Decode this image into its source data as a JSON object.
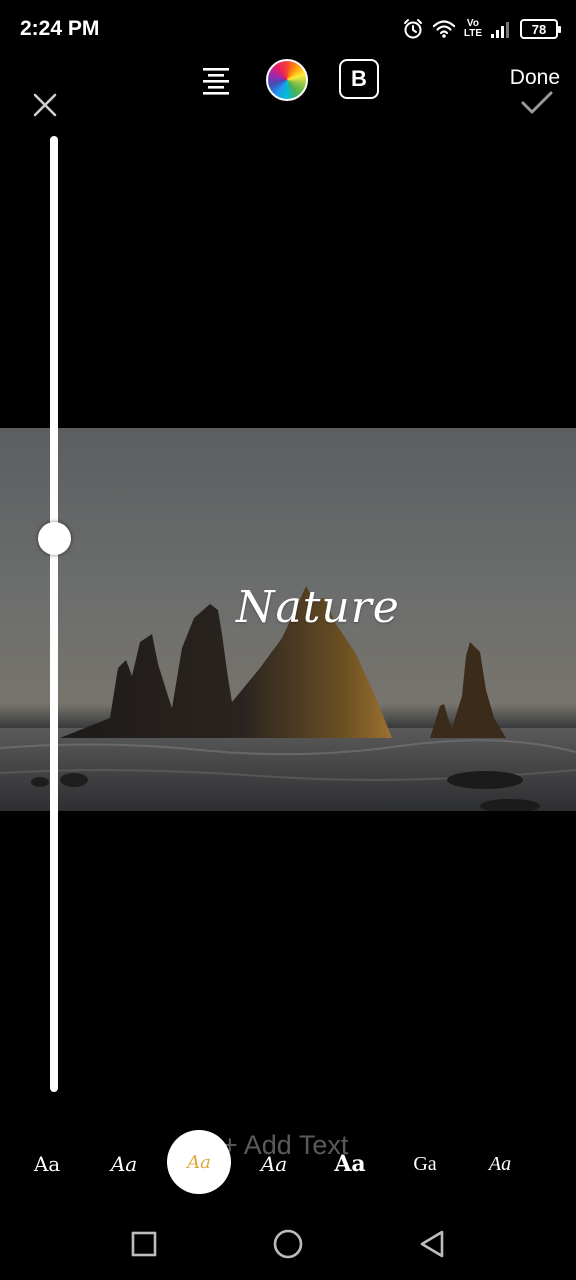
{
  "status_bar": {
    "time": "2:24 PM",
    "volte_top": "Vo",
    "volte_bottom": "LTE",
    "battery": "78",
    "icons": [
      "alarm-icon",
      "wifi-icon",
      "signal-icon",
      "battery-icon"
    ]
  },
  "toolbar": {
    "done_label": "Done",
    "bold_label": "B",
    "icons": [
      "close-icon",
      "align-center-icon",
      "color-wheel-icon",
      "bold-icon",
      "check-icon"
    ]
  },
  "canvas": {
    "overlay_text": "Nature",
    "add_text_label": "+ Add Text"
  },
  "slider": {
    "level": 0.58
  },
  "font_picker": {
    "options": [
      "Aa",
      "Aa",
      "Aa",
      "Aa",
      "Aa",
      "Ga",
      "Aa"
    ],
    "selected_index": 2,
    "selected_color": "#e0a73a"
  },
  "nav_bar": {
    "icons": [
      "recent-apps-icon",
      "home-icon",
      "back-icon"
    ]
  }
}
